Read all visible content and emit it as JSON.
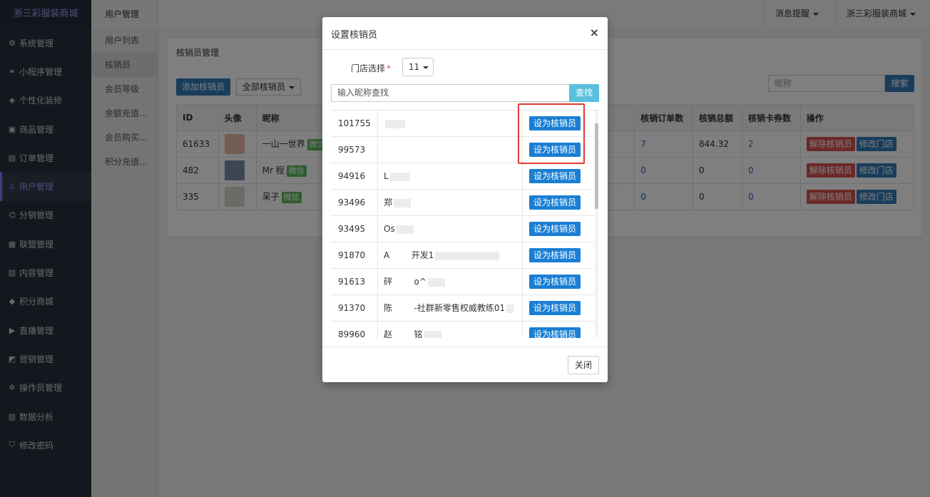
{
  "sidebar": {
    "brand": "浙三彩服装商城",
    "items": [
      {
        "label": "系统管理",
        "icon": "gear-icon",
        "glyph": "⚙"
      },
      {
        "label": "小程序管理",
        "icon": "link-icon",
        "glyph": "⚭"
      },
      {
        "label": "个性化装修",
        "icon": "brush-icon",
        "glyph": "◈"
      },
      {
        "label": "商品管理",
        "icon": "briefcase-icon",
        "glyph": "▣"
      },
      {
        "label": "订单管理",
        "icon": "clipboard-icon",
        "glyph": "▤"
      },
      {
        "label": "用户管理",
        "icon": "user-icon",
        "glyph": "♙"
      },
      {
        "label": "分销管理",
        "icon": "sitemap-icon",
        "glyph": "⌬"
      },
      {
        "label": "联盟管理",
        "icon": "store-icon",
        "glyph": "▦"
      },
      {
        "label": "内容管理",
        "icon": "newspaper-icon",
        "glyph": "▧"
      },
      {
        "label": "积分商城",
        "icon": "cube-icon",
        "glyph": "◆"
      },
      {
        "label": "直播管理",
        "icon": "play-icon",
        "glyph": "▶"
      },
      {
        "label": "营销管理",
        "icon": "bullhorn-icon",
        "glyph": "◩"
      },
      {
        "label": "操作员管理",
        "icon": "cog-icon",
        "glyph": "✲"
      },
      {
        "label": "数据分析",
        "icon": "bar-chart-icon",
        "glyph": "▥"
      },
      {
        "label": "修改密码",
        "icon": "shield-icon",
        "glyph": "⛉"
      }
    ]
  },
  "subnav": {
    "title": "用户管理",
    "items": [
      "用户列表",
      "核销员",
      "会员等级",
      "余额充值...",
      "会员购买...",
      "积分充值..."
    ]
  },
  "topbar": {
    "notifications": "消息提醒",
    "store": "浙三彩服装商城"
  },
  "main": {
    "title": "核销员管理",
    "add_button": "添加核销员",
    "filter_label": "全部核销员",
    "search_placeholder": "昵称",
    "search_button": "搜索",
    "table": {
      "headers": [
        "ID",
        "头像",
        "昵称",
        "核销订单数",
        "核销总额",
        "核销卡券数",
        "操作"
      ],
      "rows": [
        {
          "id": "61633",
          "nickname": "一山一世界",
          "badge": "微信",
          "orders": "7",
          "total": "844.32",
          "coupons": "2"
        },
        {
          "id": "482",
          "nickname": "Mr 程",
          "badge": "微信",
          "orders": "0",
          "total": "0",
          "coupons": "0"
        },
        {
          "id": "335",
          "nickname": "呆子",
          "badge": "微信",
          "orders": "0",
          "total": "0",
          "coupons": "0"
        }
      ],
      "remove_label": "解除核销员",
      "edit_store_label": "修改门店"
    }
  },
  "modal": {
    "title": "设置核销员",
    "close_glyph": "×",
    "store_label": "门店选择",
    "required_mark": "*",
    "store_value": "11",
    "nick_placeholder": "输入昵称查找",
    "find_button": "查找",
    "set_label": "设为核销员",
    "footer_close": "关闭",
    "rows": [
      {
        "id": "101755",
        "name": ""
      },
      {
        "id": "99573",
        "name": ""
      },
      {
        "id": "94916",
        "name": "L"
      },
      {
        "id": "93496",
        "name": "郑"
      },
      {
        "id": "93495",
        "name": "Os"
      },
      {
        "id": "91870",
        "name": "A        开发1"
      },
      {
        "id": "91613",
        "name": "砰        o^"
      },
      {
        "id": "91370",
        "name": "陈        -社群新零售权威教练01"
      },
      {
        "id": "89960",
        "name": "赵        铭"
      }
    ]
  }
}
